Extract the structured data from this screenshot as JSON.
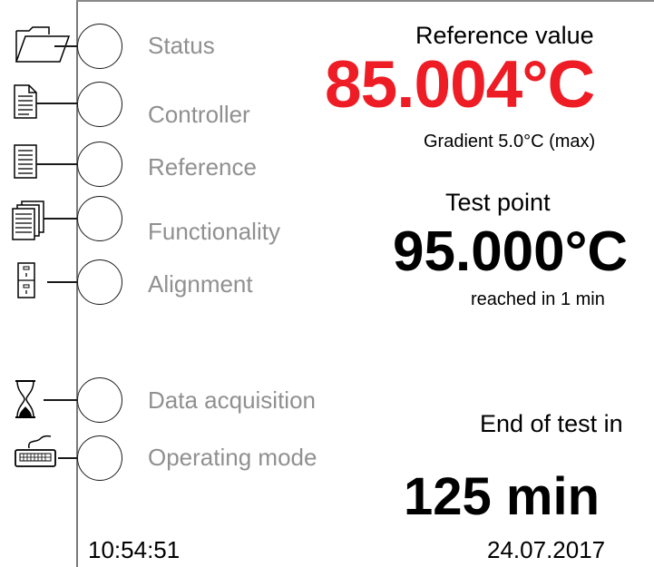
{
  "nav": {
    "items": [
      {
        "label": "Status",
        "icon": "folder-icon"
      },
      {
        "label": "Controller",
        "icon": "document-icon"
      },
      {
        "label": "Reference",
        "icon": "list-document-icon"
      },
      {
        "label": "Functionality",
        "icon": "stacked-documents-icon"
      },
      {
        "label": "Alignment",
        "icon": "file-cabinet-icon"
      },
      {
        "label": "Data acquisition",
        "icon": "hourglass-icon"
      },
      {
        "label": "Operating mode",
        "icon": "keyboard-icon"
      }
    ]
  },
  "reference": {
    "title": "Reference value",
    "value": "85.004°C",
    "value_color": "#ee1c24",
    "gradient": "Gradient 5.0°C (max)"
  },
  "test_point": {
    "title": "Test point",
    "value": "95.000°C",
    "reached": "reached in 1 min"
  },
  "end_of_test": {
    "title": "End of test in",
    "value": "125 min"
  },
  "footer": {
    "time": "10:54:51",
    "date": "24.07.2017"
  }
}
